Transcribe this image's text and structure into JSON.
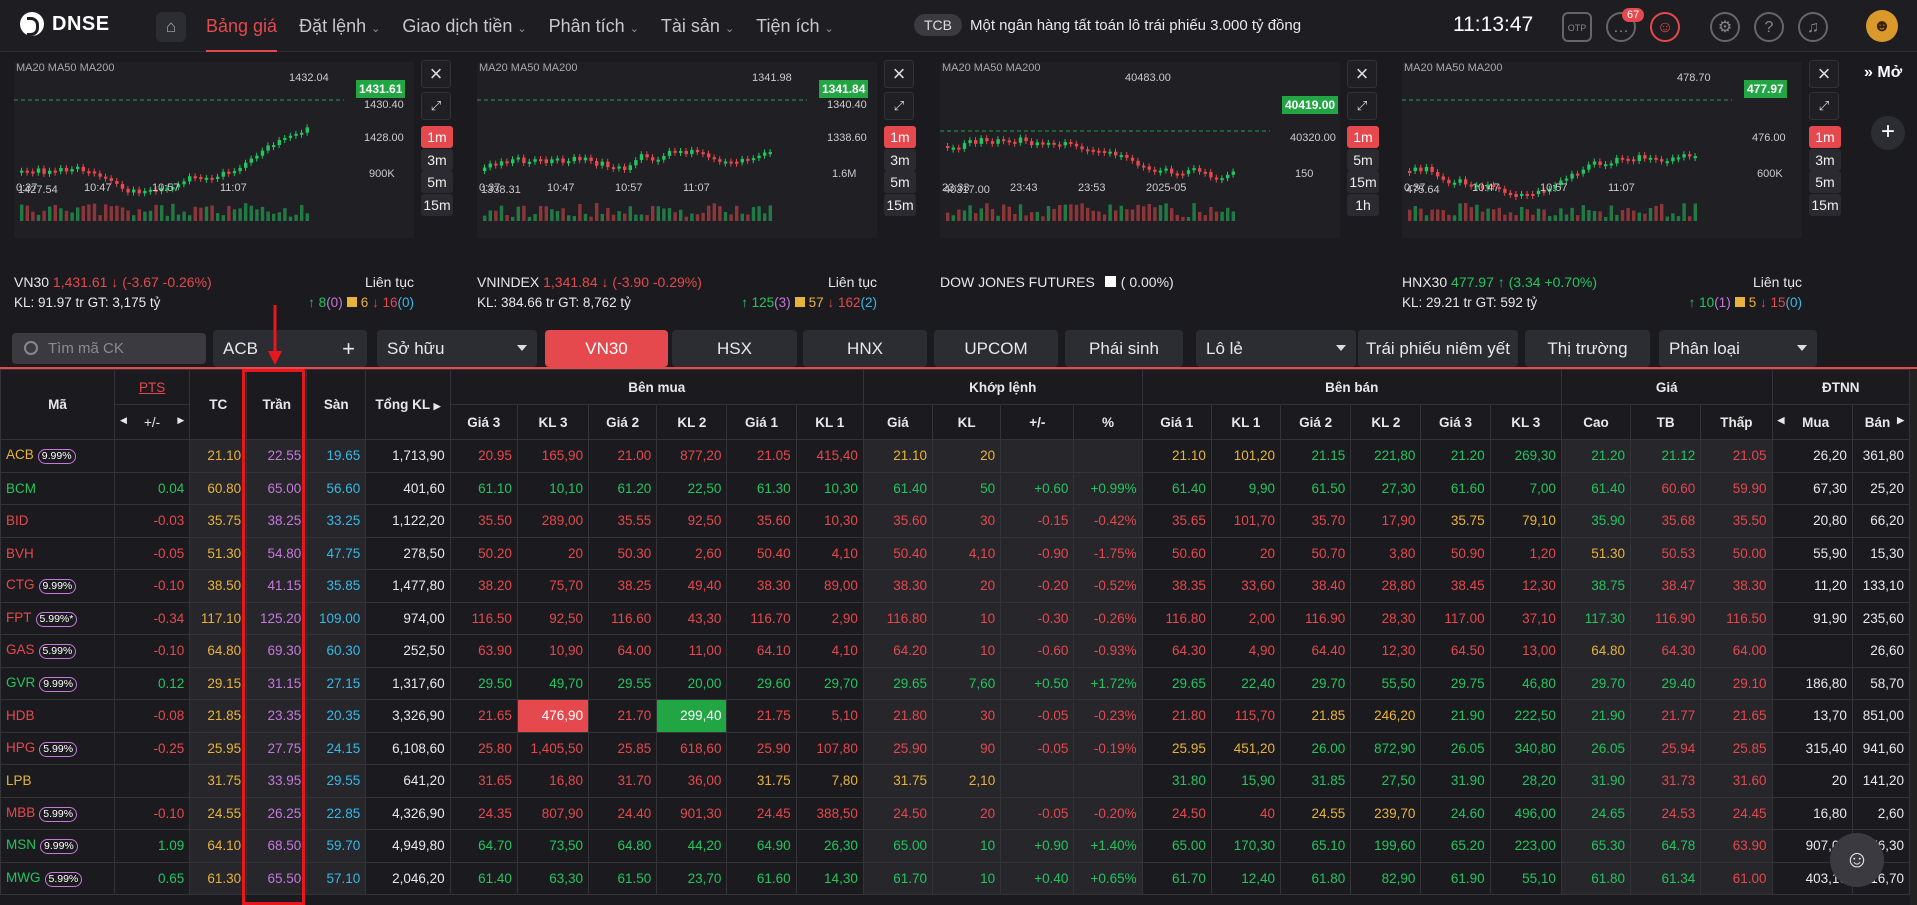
{
  "header": {
    "logo": "DNSE",
    "nav": [
      {
        "label": "Bảng giá",
        "active": true,
        "caret": false
      },
      {
        "label": "Đặt lệnh",
        "caret": true
      },
      {
        "label": "Giao dịch tiền",
        "caret": true
      },
      {
        "label": "Phân tích",
        "caret": true
      },
      {
        "label": "Tài sản",
        "caret": true
      },
      {
        "label": "Tiện ích",
        "caret": true
      }
    ],
    "news_tag": "TCB",
    "news_text": "Một ngân hàng tất toán lô trái phiếu 3.000 tỷ đồng",
    "clock": "11:13:47",
    "notif_count": "67"
  },
  "charts": [
    {
      "ma": "MA20 MA50 MA200",
      "price_tag": "1431.61",
      "hi": "1432.04",
      "lo": "1427.54",
      "y1": "1430.40",
      "y2": "1428.00",
      "vol": "900K",
      "times": [
        "0:37",
        "10:47",
        "10:57",
        "11:07"
      ],
      "tfs": [
        "1m",
        "3m",
        "5m",
        "15m"
      ],
      "name": "VN30",
      "price": "1,431.61",
      "chg": "(-3.67 -0.26%)",
      "status": "Liên tục",
      "kl": "KL: 91.97 tr",
      "gt": "GT: 3,175 tỷ",
      "up": "8",
      "ceil": "(0)",
      "ref": "6",
      "down": "16",
      "floor": "(0)",
      "dir": "down"
    },
    {
      "ma": "MA20 MA50 MA200",
      "price_tag": "1341.84",
      "hi": "1341.98",
      "lo": "1338.31",
      "y1": "1340.40",
      "y2": "1338.60",
      "vol": "1.6M",
      "times": [
        "0:37",
        "10:47",
        "10:57",
        "11:07"
      ],
      "tfs": [
        "1m",
        "3m",
        "5m",
        "15m"
      ],
      "name": "VNINDEX",
      "price": "1,341.84",
      "chg": "(-3.90 -0.29%)",
      "status": "Liên tục",
      "kl": "KL: 384.66 tr",
      "gt": "GT: 8,762 tỷ",
      "up": "125",
      "ceil": "(3)",
      "ref": "57",
      "down": "162",
      "floor": "(2)",
      "dir": "down"
    },
    {
      "ma": "MA20 MA50 MA200",
      "price_tag": "40419.00",
      "hi": "40483.00",
      "lo": "40317.00",
      "y1": "",
      "y2": "40320.00",
      "vol": "150",
      "times": [
        "23:33",
        "23:43",
        "23:53",
        "2025-05"
      ],
      "tfs": [
        "1m",
        "5m",
        "15m",
        "1h"
      ],
      "name": "DOW JONES FUTURES",
      "price": "",
      "chg": "( 0.00%)",
      "status": "",
      "kl": "",
      "gt": "",
      "up": "",
      "ceil": "",
      "ref": "",
      "down": "",
      "floor": "",
      "dir": "none"
    },
    {
      "ma": "MA20 MA50 MA200",
      "price_tag": "477.97",
      "hi": "478.70",
      "lo": "475.64",
      "y1": "",
      "y2": "476.00",
      "vol": "600K",
      "times": [
        "0:37",
        "10:47",
        "10:57",
        "11:07"
      ],
      "tfs": [
        "1m",
        "3m",
        "5m",
        "15m"
      ],
      "name": "HNX30",
      "price": "477.97",
      "chg": "(3.34 +0.70%)",
      "status": "Liên tục",
      "kl": "KL: 29.21 tr",
      "gt": "GT: 592 tỷ",
      "up": "10",
      "ceil": "(1)",
      "ref": "5",
      "down": "15",
      "floor": "(0)",
      "dir": "up"
    }
  ],
  "side": {
    "more_label": "Mở"
  },
  "tabs": {
    "search_placeholder": "Tìm mã CK",
    "watch": "ACB",
    "owned": "Sở hữu",
    "items": [
      "VN30",
      "HSX",
      "HNX",
      "UPCOM",
      "Phái sinh"
    ],
    "odd": "Lô lẻ",
    "bonds": "Trái phiếu niêm yết",
    "market": "Thị trường",
    "classify": "Phân loại"
  },
  "table": {
    "groups": {
      "buy": "Bên mua",
      "match": "Khớp lệnh",
      "sell": "Bên bán",
      "price": "Giá",
      "foreign": "ĐTNN"
    },
    "cols": {
      "sym": "Mã",
      "pts": "PTS",
      "pm": "+/-",
      "tc": "TC",
      "tran": "Trần",
      "san": "Sàn",
      "vol": "Tổng KL",
      "g3": "Giá 3",
      "kl3": "KL 3",
      "g2": "Giá 2",
      "kl2": "KL 2",
      "g1": "Giá 1",
      "kl1": "KL 1",
      "mp": "Giá",
      "mkl": "KL",
      "mpm": "+/-",
      "mpc": "%",
      "s1": "Giá 1",
      "sk1": "KL 1",
      "s2": "Giá 2",
      "sk2": "KL 2",
      "s3": "Giá 3",
      "sk3": "KL 3",
      "hi": "Cao",
      "avg": "TB",
      "lo": "Thấp",
      "fb": "Mua",
      "fs": "Bán"
    },
    "rows": [
      {
        "s": "ACB",
        "p": "9.99%",
        "pm": "",
        "tc": "21.10",
        "tr": "22.55",
        "sa": "19.65",
        "v": "1,713,90",
        "b": [
          "20.95",
          "165,90",
          "21.00",
          "877,20",
          "21.05",
          "415,40"
        ],
        "m": [
          "21.10",
          "20",
          "",
          ""
        ],
        "a": [
          "21.10",
          "101,20",
          "21.15",
          "221,80",
          "21.20",
          "269,30"
        ],
        "h": [
          "21.20",
          "21.12",
          "21.05"
        ],
        "f": [
          "26,20",
          "361,80"
        ]
      },
      {
        "s": "BCM",
        "p": "",
        "pm": "0.04",
        "tc": "60.80",
        "tr": "65.00",
        "sa": "56.60",
        "v": "401,60",
        "b": [
          "61.10",
          "10,10",
          "61.20",
          "22,50",
          "61.30",
          "10,30"
        ],
        "m": [
          "61.40",
          "50",
          "+0.60",
          "+0.99%"
        ],
        "a": [
          "61.40",
          "9,90",
          "61.50",
          "27,30",
          "61.60",
          "7,00"
        ],
        "h": [
          "61.40",
          "60.60",
          "59.90"
        ],
        "f": [
          "67,30",
          "25,20"
        ]
      },
      {
        "s": "BID",
        "p": "",
        "pm": "-0.03",
        "tc": "35.75",
        "tr": "38.25",
        "sa": "33.25",
        "v": "1,122,20",
        "b": [
          "35.50",
          "289,00",
          "35.55",
          "92,50",
          "35.60",
          "10,30"
        ],
        "m": [
          "35.60",
          "30",
          "-0.15",
          "-0.42%"
        ],
        "a": [
          "35.65",
          "101,70",
          "35.70",
          "17,90",
          "35.75",
          "79,10"
        ],
        "h": [
          "35.90",
          "35.68",
          "35.50"
        ],
        "f": [
          "20,80",
          "66,20"
        ]
      },
      {
        "s": "BVH",
        "p": "",
        "pm": "-0.05",
        "tc": "51.30",
        "tr": "54.80",
        "sa": "47.75",
        "v": "278,50",
        "b": [
          "50.20",
          "20",
          "50.30",
          "2,60",
          "50.40",
          "4,10"
        ],
        "m": [
          "50.40",
          "4,10",
          "-0.90",
          "-1.75%"
        ],
        "a": [
          "50.60",
          "20",
          "50.70",
          "3,80",
          "50.90",
          "1,20"
        ],
        "h": [
          "51.30",
          "50.53",
          "50.00"
        ],
        "f": [
          "55,90",
          "15,30"
        ]
      },
      {
        "s": "CTG",
        "p": "9.99%",
        "pm": "-0.10",
        "tc": "38.50",
        "tr": "41.15",
        "sa": "35.85",
        "v": "1,477,80",
        "b": [
          "38.20",
          "75,70",
          "38.25",
          "49,40",
          "38.30",
          "89,00"
        ],
        "m": [
          "38.30",
          "20",
          "-0.20",
          "-0.52%"
        ],
        "a": [
          "38.35",
          "33,60",
          "38.40",
          "28,80",
          "38.45",
          "12,30"
        ],
        "h": [
          "38.75",
          "38.47",
          "38.30"
        ],
        "f": [
          "11,20",
          "133,10"
        ]
      },
      {
        "s": "FPT",
        "p": "5.99%*",
        "pm": "-0.34",
        "tc": "117.10",
        "tr": "125.20",
        "sa": "109.00",
        "v": "974,00",
        "b": [
          "116.50",
          "92,50",
          "116.60",
          "43,30",
          "116.70",
          "2,90"
        ],
        "m": [
          "116.80",
          "10",
          "-0.30",
          "-0.26%"
        ],
        "a": [
          "116.80",
          "2,00",
          "116.90",
          "28,30",
          "117.00",
          "37,10"
        ],
        "h": [
          "117.30",
          "116.90",
          "116.50"
        ],
        "f": [
          "91,90",
          "235,60"
        ]
      },
      {
        "s": "GAS",
        "p": "5.99%",
        "pm": "-0.10",
        "tc": "64.80",
        "tr": "69.30",
        "sa": "60.30",
        "v": "252,50",
        "b": [
          "63.90",
          "10,90",
          "64.00",
          "11,00",
          "64.10",
          "4,10"
        ],
        "m": [
          "64.20",
          "10",
          "-0.60",
          "-0.93%"
        ],
        "a": [
          "64.30",
          "4,90",
          "64.40",
          "12,30",
          "64.50",
          "13,00"
        ],
        "h": [
          "64.80",
          "64.30",
          "64.00"
        ],
        "f": [
          "",
          "26,60"
        ]
      },
      {
        "s": "GVR",
        "p": "9.99%",
        "pm": "0.12",
        "tc": "29.15",
        "tr": "31.15",
        "sa": "27.15",
        "v": "1,317,60",
        "b": [
          "29.50",
          "49,70",
          "29.55",
          "20,00",
          "29.60",
          "29,70"
        ],
        "m": [
          "29.65",
          "7,60",
          "+0.50",
          "+1.72%"
        ],
        "a": [
          "29.65",
          "22,40",
          "29.70",
          "55,50",
          "29.75",
          "46,80"
        ],
        "h": [
          "29.70",
          "29.40",
          "29.10"
        ],
        "f": [
          "186,80",
          "58,70"
        ]
      },
      {
        "s": "HDB",
        "p": "",
        "pm": "-0.08",
        "tc": "21.85",
        "tr": "23.35",
        "sa": "20.35",
        "v": "3,326,90",
        "b": [
          "21.65",
          "476,90",
          "21.70",
          "299,40",
          "21.75",
          "5,10"
        ],
        "m": [
          "21.80",
          "30",
          "-0.05",
          "-0.23%"
        ],
        "a": [
          "21.80",
          "115,70",
          "21.85",
          "246,20",
          "21.90",
          "222,50"
        ],
        "h": [
          "21.90",
          "21.77",
          "21.65"
        ],
        "f": [
          "13,70",
          "851,00"
        ]
      },
      {
        "s": "HPG",
        "p": "5.99%",
        "pm": "-0.25",
        "tc": "25.95",
        "tr": "27.75",
        "sa": "24.15",
        "v": "6,108,60",
        "b": [
          "25.80",
          "1,405,50",
          "25.85",
          "618,60",
          "25.90",
          "107,80"
        ],
        "m": [
          "25.90",
          "90",
          "-0.05",
          "-0.19%"
        ],
        "a": [
          "25.95",
          "451,20",
          "26.00",
          "872,90",
          "26.05",
          "340,80"
        ],
        "h": [
          "26.05",
          "25.94",
          "25.85"
        ],
        "f": [
          "315,40",
          "941,60"
        ]
      },
      {
        "s": "LPB",
        "p": "",
        "pm": "",
        "tc": "31.75",
        "tr": "33.95",
        "sa": "29.55",
        "v": "641,20",
        "b": [
          "31.65",
          "16,80",
          "31.70",
          "36,00",
          "31.75",
          "7,80"
        ],
        "m": [
          "31.75",
          "2,10",
          "",
          ""
        ],
        "a": [
          "31.80",
          "15,90",
          "31.85",
          "27,50",
          "31.90",
          "28,20"
        ],
        "h": [
          "31.90",
          "31.73",
          "31.60"
        ],
        "f": [
          "20",
          "141,20"
        ]
      },
      {
        "s": "MBB",
        "p": "5.99%",
        "pm": "-0.10",
        "tc": "24.55",
        "tr": "26.25",
        "sa": "22.85",
        "v": "4,326,90",
        "b": [
          "24.35",
          "807,90",
          "24.40",
          "901,30",
          "24.45",
          "388,50"
        ],
        "m": [
          "24.50",
          "20",
          "-0.05",
          "-0.20%"
        ],
        "a": [
          "24.50",
          "40",
          "24.55",
          "239,70",
          "24.60",
          "496,00"
        ],
        "h": [
          "24.65",
          "24.53",
          "24.45"
        ],
        "f": [
          "16,80",
          "2,60"
        ]
      },
      {
        "s": "MSN",
        "p": "9.99%",
        "pm": "1.09",
        "tc": "64.10",
        "tr": "68.50",
        "sa": "59.70",
        "v": "4,949,80",
        "b": [
          "64.70",
          "73,50",
          "64.80",
          "44,20",
          "64.90",
          "26,30"
        ],
        "m": [
          "65.00",
          "10",
          "+0.90",
          "+1.40%"
        ],
        "a": [
          "65.00",
          "170,30",
          "65.10",
          "199,60",
          "65.20",
          "223,00"
        ],
        "h": [
          "65.30",
          "64.78",
          "63.90"
        ],
        "f": [
          "907,00",
          "576,30"
        ]
      },
      {
        "s": "MWG",
        "p": "5.99%",
        "pm": "0.65",
        "tc": "61.30",
        "tr": "65.50",
        "sa": "57.10",
        "v": "2,046,20",
        "b": [
          "61.40",
          "63,30",
          "61.50",
          "23,70",
          "61.60",
          "14,30"
        ],
        "m": [
          "61.70",
          "10",
          "+0.40",
          "+0.65%"
        ],
        "a": [
          "61.70",
          "12,40",
          "61.80",
          "82,90",
          "61.90",
          "55,10"
        ],
        "h": [
          "61.80",
          "61.34",
          "61.00"
        ],
        "f": [
          "403,10",
          "216,70"
        ]
      }
    ]
  }
}
